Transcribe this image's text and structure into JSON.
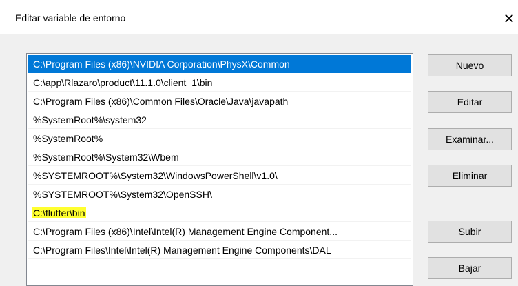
{
  "dialog": {
    "title": "Editar variable de entorno",
    "close_glyph": "✕"
  },
  "paths": [
    "C:\\Program Files (x86)\\NVIDIA Corporation\\PhysX\\Common",
    "C:\\app\\Rlazaro\\product\\11.1.0\\client_1\\bin",
    "C:\\Program Files (x86)\\Common Files\\Oracle\\Java\\javapath",
    "%SystemRoot%\\system32",
    "%SystemRoot%",
    "%SystemRoot%\\System32\\Wbem",
    "%SYSTEMROOT%\\System32\\WindowsPowerShell\\v1.0\\",
    "%SYSTEMROOT%\\System32\\OpenSSH\\",
    "C:\\flutter\\bin",
    "C:\\Program Files (x86)\\Intel\\Intel(R) Management Engine Component...",
    "C:\\Program Files\\Intel\\Intel(R) Management Engine Components\\DAL"
  ],
  "selected_index": 0,
  "highlighted_index": 8,
  "buttons": {
    "nuevo": "Nuevo",
    "editar": "Editar",
    "examinar": "Examinar...",
    "eliminar": "Eliminar",
    "subir": "Subir",
    "bajar": "Bajar"
  },
  "colors": {
    "selection": "#0078d7",
    "highlight": "#ffff30"
  }
}
